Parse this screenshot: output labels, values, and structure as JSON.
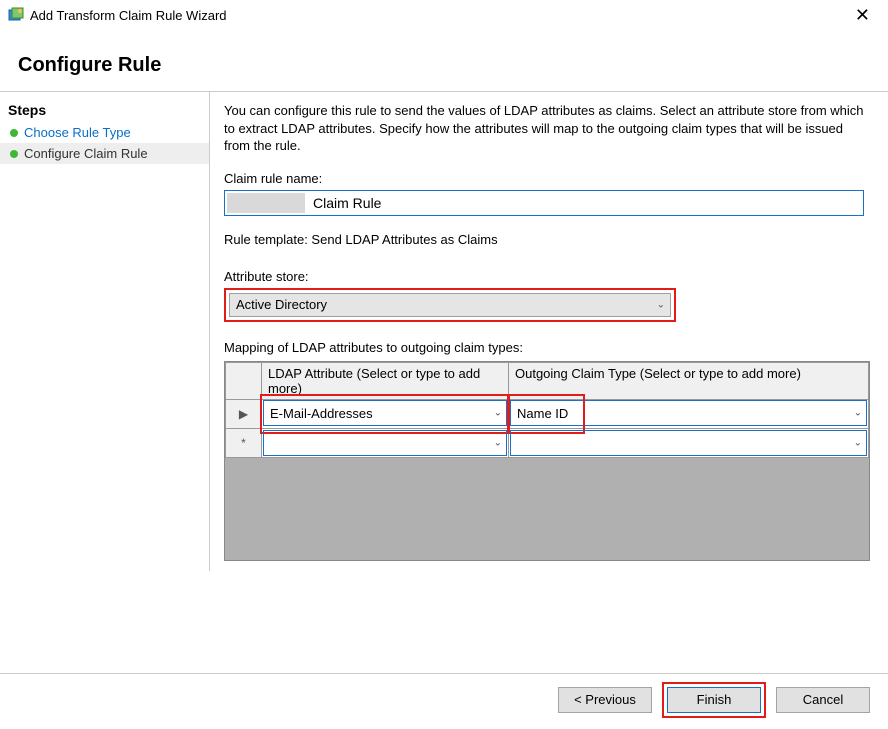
{
  "titlebar": {
    "title": "Add Transform Claim Rule Wizard"
  },
  "heading": "Configure Rule",
  "sidebar": {
    "title": "Steps",
    "items": [
      {
        "label": "Choose Rule Type",
        "active": false,
        "link": true
      },
      {
        "label": "Configure Claim Rule",
        "active": true,
        "link": false
      }
    ]
  },
  "main": {
    "description": "You can configure this rule to send the values of LDAP attributes as claims. Select an attribute store from which to extract LDAP attributes. Specify how the attributes will map to the outgoing claim types that will be issued from the rule.",
    "claimRuleNameLabel": "Claim rule name:",
    "claimRuleNameValue": "Claim Rule",
    "ruleTemplateLabel": "Rule template: Send LDAP Attributes as Claims",
    "attributeStoreLabel": "Attribute store:",
    "attributeStoreValue": "Active Directory",
    "mappingLabel": "Mapping of LDAP attributes to outgoing claim types:",
    "columns": {
      "ldap": "LDAP Attribute (Select or type to add more)",
      "claim": "Outgoing Claim Type (Select or type to add more)"
    },
    "rows": [
      {
        "marker": "▶",
        "ldap": "E-Mail-Addresses",
        "claim": "Name ID"
      },
      {
        "marker": "*",
        "ldap": "",
        "claim": ""
      }
    ]
  },
  "footer": {
    "previous": "< Previous",
    "finish": "Finish",
    "cancel": "Cancel"
  }
}
